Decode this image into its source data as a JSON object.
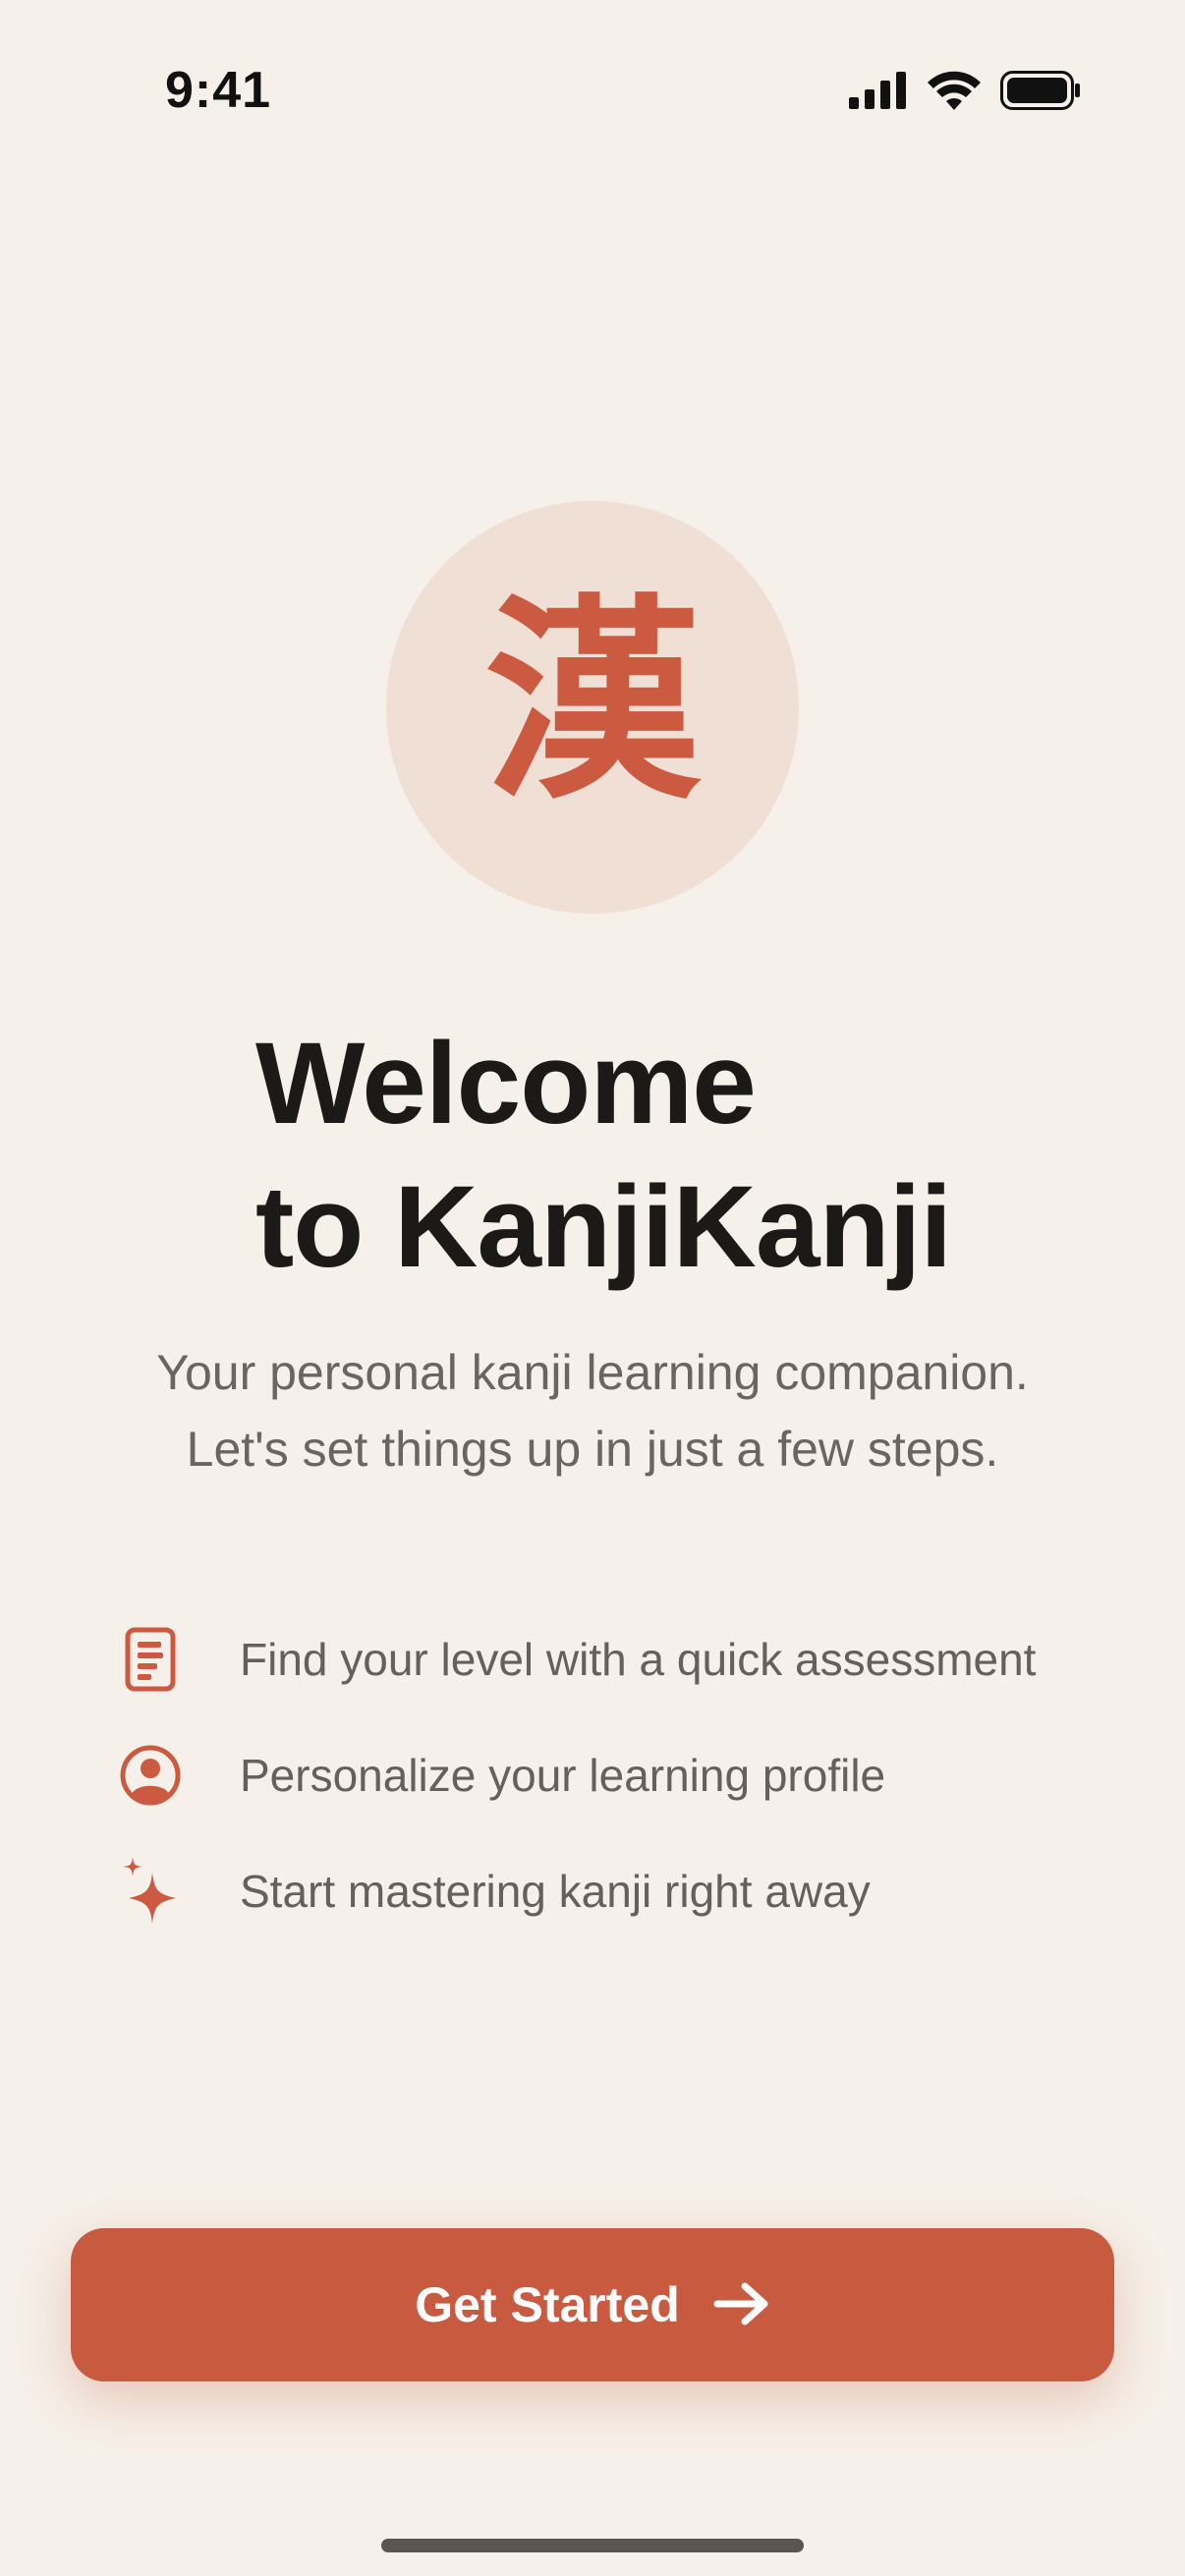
{
  "status_bar": {
    "time": "9:41",
    "icons": [
      "cellular-signal-icon",
      "wifi-icon",
      "battery-icon"
    ]
  },
  "hero": {
    "kanji": "漢",
    "badge_color": "#efdfd4",
    "accent": "#cc5a40"
  },
  "title": {
    "line1": "Welcome",
    "line2": "to KanjiKanji"
  },
  "subtitle": {
    "line1": "Your personal kanji learning companion.",
    "line2": "Let's set things up in just a few steps."
  },
  "features": [
    {
      "icon": "assessment-document-icon",
      "label": "Find your level with a quick assessment"
    },
    {
      "icon": "profile-user-icon",
      "label": "Personalize your learning profile"
    },
    {
      "icon": "sparkles-icon",
      "label": "Start mastering kanji right away"
    }
  ],
  "cta": {
    "label": "Get Started",
    "icon": "arrow-right-icon",
    "color": "#c85a40"
  }
}
